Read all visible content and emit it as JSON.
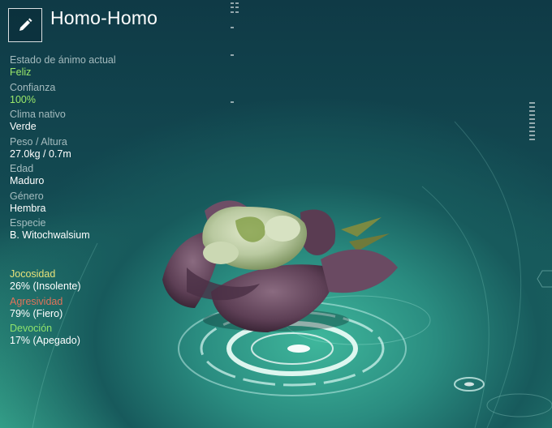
{
  "creature": {
    "name": "Homo-Homo"
  },
  "icons": {
    "edit": "pencil-icon"
  },
  "stats": [
    {
      "key": "mood",
      "label": "Estado de ánimo actual",
      "value": "Feliz"
    },
    {
      "key": "trust",
      "label": "Confianza",
      "value": "100%"
    },
    {
      "key": "climate",
      "label": "Clima nativo",
      "value": "Verde"
    },
    {
      "key": "size",
      "label": "Peso / Altura",
      "value": "27.0kg / 0.7m"
    },
    {
      "key": "age",
      "label": "Edad",
      "value": "Maduro"
    },
    {
      "key": "gender",
      "label": "Género",
      "value": "Hembra"
    },
    {
      "key": "species",
      "label": "Especie",
      "value": "B. Witochwalsium"
    }
  ],
  "traits": [
    {
      "key": "playfulness",
      "label": "Jocosidad",
      "value": "26% (Insolente)",
      "color": "#e8e27a"
    },
    {
      "key": "aggression",
      "label": "Agresividad",
      "value": "79% (Fiero)",
      "color": "#e0735a"
    },
    {
      "key": "devotion",
      "label": "Devoción",
      "value": "17% (Apegado)",
      "color": "#8fe36c"
    }
  ],
  "colors": {
    "mood": "#9be86a",
    "accent": "#2fb59a",
    "text": "#ffffff"
  }
}
